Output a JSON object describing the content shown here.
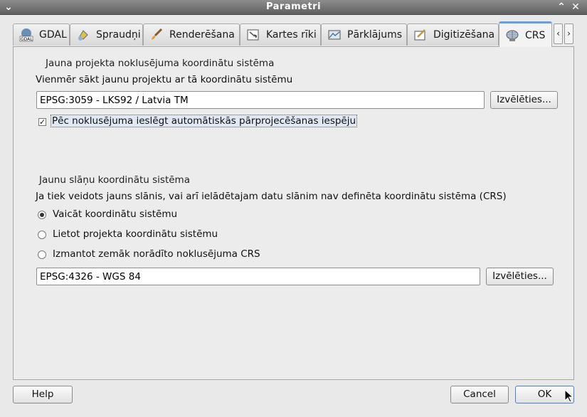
{
  "window": {
    "title": "Parametri"
  },
  "tabs": [
    {
      "label": "GDAL",
      "icon": "gdal-icon"
    },
    {
      "label": "Spraudņi",
      "icon": "plugins-icon"
    },
    {
      "label": "Renderēšana",
      "icon": "brush-icon"
    },
    {
      "label": "Kartes rīki",
      "icon": "map-tools-icon"
    },
    {
      "label": "Pārklājums",
      "icon": "overlay-icon"
    },
    {
      "label": "Digitizēšana",
      "icon": "digitize-icon"
    },
    {
      "label": "CRS",
      "icon": "globe-icon"
    }
  ],
  "active_tab": "CRS",
  "project_crs": {
    "group_title": "Jauna projekta noklusējuma koordinātu sistēma",
    "description": "Vienmēr sākt jaunu projektu ar tā koordinātu sistēmu",
    "value": "EPSG:3059 - LKS92 / Latvia TM",
    "select_label": "Izvēlēties...",
    "auto_reproject_label": "Pēc noklusējuma ieslēgt automātiskās pārprojecēšanas iespēju",
    "auto_reproject_checked": true
  },
  "layer_crs": {
    "group_title": "Jaunu slāņu koordinātu sistēma",
    "description": "Ja tiek veidots jauns slānis, vai arī ielādētajam datu slānim nav definēta koordinātu sistēma (CRS)",
    "options": [
      {
        "label": "Vaicāt koordinātu sistēmu",
        "selected": true
      },
      {
        "label": "Lietot projekta koordinātu sistēmu",
        "selected": false
      },
      {
        "label": "Izmantot zemāk norādīto noklusējuma CRS",
        "selected": false
      }
    ],
    "value": "EPSG:4326 - WGS 84",
    "select_label": "Izvēlēties..."
  },
  "footer": {
    "help_label": "Help",
    "cancel_label": "Cancel",
    "ok_label": "OK"
  }
}
